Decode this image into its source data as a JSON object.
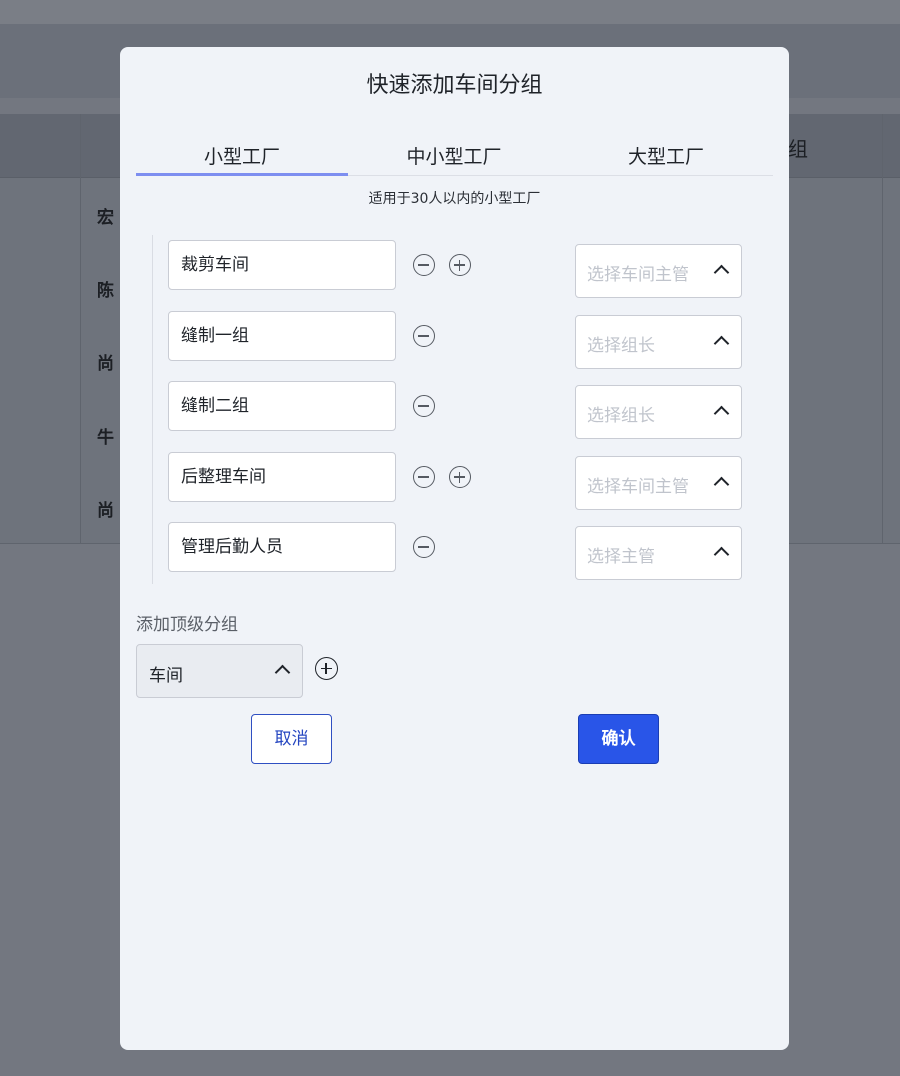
{
  "background": {
    "header_partial": "组",
    "rows": [
      "宏",
      "陈",
      "尚",
      "牛",
      "尚"
    ]
  },
  "modal": {
    "title": "快速添加车间分组",
    "tabs": [
      {
        "label": "小型工厂",
        "active": true
      },
      {
        "label": "中小型工厂",
        "active": false
      },
      {
        "label": "大型工厂",
        "active": false
      }
    ],
    "description": "适用于30人以内的小型工厂",
    "groups": [
      {
        "name": "裁剪车间",
        "placeholder": "选择车间主管",
        "can_add_child": true
      },
      {
        "name": "缝制一组",
        "placeholder": "选择组长",
        "can_add_child": false
      },
      {
        "name": "缝制二组",
        "placeholder": "选择组长",
        "can_add_child": false
      },
      {
        "name": "后整理车间",
        "placeholder": "选择车间主管",
        "can_add_child": true
      },
      {
        "name": "管理后勤人员",
        "placeholder": "选择主管",
        "can_add_child": false
      }
    ],
    "top_level": {
      "label": "添加顶级分组",
      "selected": "车间"
    },
    "buttons": {
      "cancel": "取消",
      "confirm": "确认"
    }
  },
  "colors": {
    "overlay": "#737780",
    "modal_bg": "#f0f3f8",
    "active_tab": "#7d8ef0",
    "primary": "#2955e8",
    "placeholder": "#c0c4cc"
  }
}
